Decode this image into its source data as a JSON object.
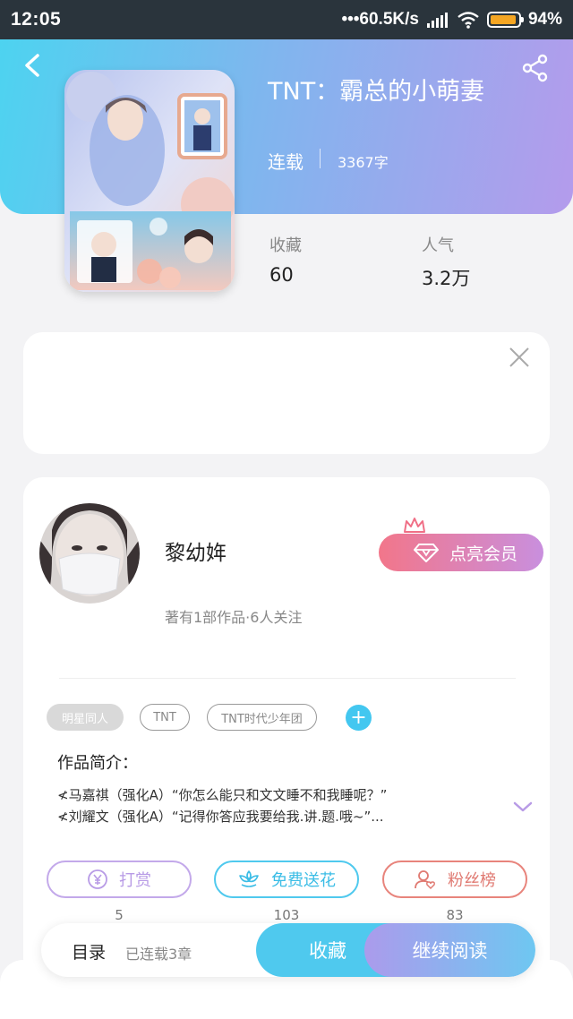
{
  "status_bar": {
    "time": "12:05",
    "speed": "•••60.5K/s",
    "battery_percent": "94%",
    "battery_level": 0.94
  },
  "book": {
    "title": "TNT：霸总的小萌妻",
    "status": "连载",
    "word_count": "3367字",
    "stats": [
      {
        "label": "收藏",
        "value": "60"
      },
      {
        "label": "人气",
        "value": "3.2万"
      }
    ]
  },
  "author": {
    "name": "黎幼姩",
    "meta": "著有1部作品·6人关注",
    "vip_label": "点亮会员"
  },
  "tags": [
    "明星同人",
    "TNT",
    "TNT时代少年团"
  ],
  "intro": {
    "label": "作品简介：",
    "lines": [
      "≮马嘉祺（强化A）“你怎么能只和文文睡不和我睡呢？”",
      "≮刘耀文（强化A）“记得你答应我要给我.讲.题.哦~”..."
    ]
  },
  "actions": [
    {
      "label": "打赏",
      "count": "5",
      "color": "#b89be6",
      "icon": "yen-coin-icon"
    },
    {
      "label": "免费送花",
      "count": "103",
      "color": "#4fc9ee",
      "icon": "flower-icon"
    },
    {
      "label": "粉丝榜",
      "count": "83",
      "color": "#e8847c",
      "icon": "fan-user-icon"
    }
  ],
  "bottom_bar": {
    "toc_label": "目录",
    "chapters_label": "已连载3章",
    "collect_label": "收藏",
    "read_label": "继续阅读"
  }
}
